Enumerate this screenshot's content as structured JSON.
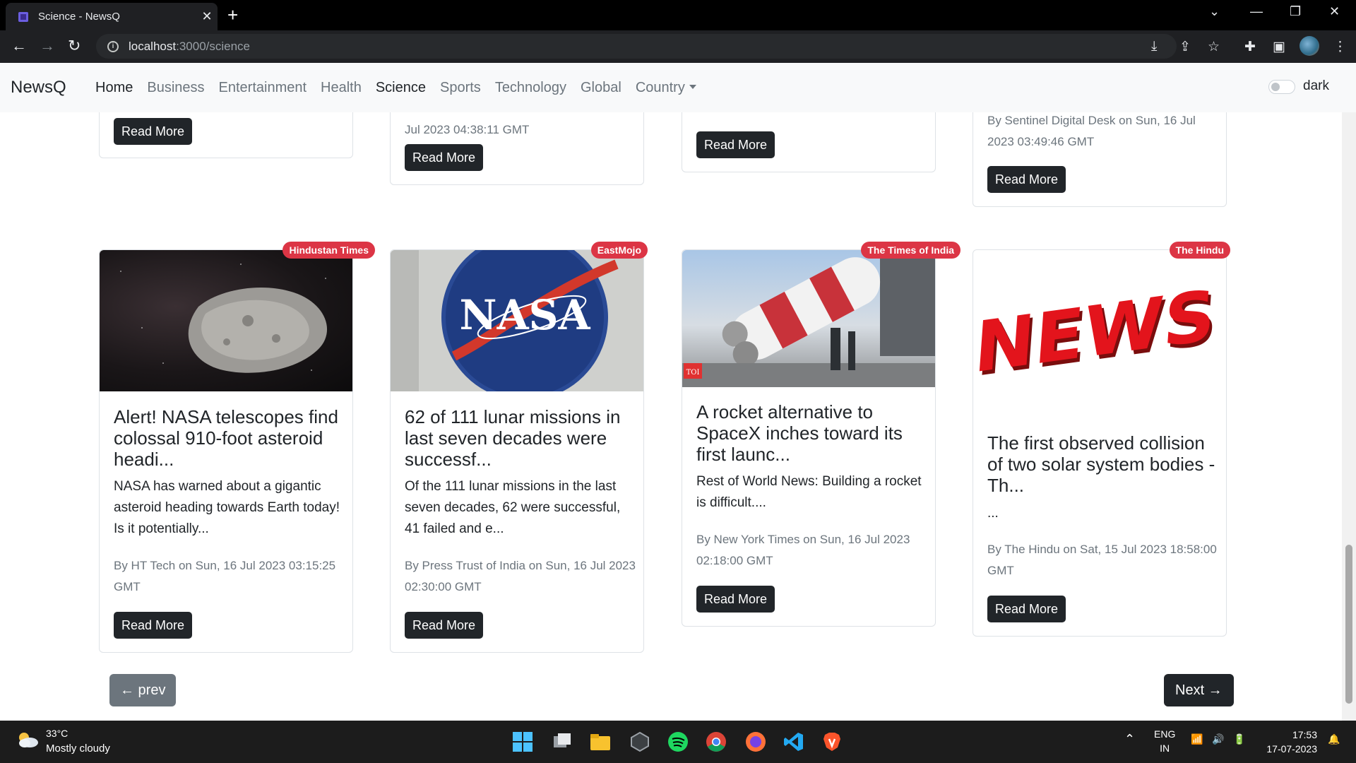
{
  "browser": {
    "tab_title": "Science - NewsQ",
    "tab_close": "✕",
    "new_tab": "+",
    "url_host": "localhost",
    "url_path": ":3000/science"
  },
  "navbar": {
    "brand": "NewsQ",
    "links": [
      "Home",
      "Business",
      "Entertainment",
      "Health",
      "Science",
      "Sports",
      "Technology",
      "Global",
      "Country"
    ],
    "dark_label": "dark"
  },
  "top_cards": [
    {
      "meta": "",
      "button": "Read More"
    },
    {
      "meta": "Jul 2023 04:38:11 GMT",
      "button": "Read More"
    },
    {
      "meta": "",
      "button": "Read More"
    },
    {
      "meta": "By Sentinel Digital Desk on Sun, 16 Jul 2023 03:49:46 GMT",
      "button": "Read More"
    }
  ],
  "cards": [
    {
      "source": "Hindustan Times",
      "title": "Alert! NASA telescopes find colossal 910-foot asteroid headi...",
      "description": "NASA has warned about a gigantic asteroid heading towards Earth today! Is it potentially...",
      "meta": "By HT Tech on Sun, 16 Jul 2023 03:15:25 GMT",
      "button": "Read More"
    },
    {
      "source": "EastMojo",
      "title": "62 of 111 lunar missions in last seven decades were successf...",
      "description": "Of the 111 lunar missions in the last seven decades, 62 were successful, 41 failed and e...",
      "meta": "By Press Trust of India on Sun, 16 Jul 2023 02:30:00 GMT",
      "button": "Read More",
      "image_text": "NASA"
    },
    {
      "source": "The Times of India",
      "title": "A rocket alternative to SpaceX inches toward its first launc...",
      "description": "Rest of World News: Building a rocket is difficult....",
      "meta": "By New York Times on Sun, 16 Jul 2023 02:18:00 GMT",
      "button": "Read More",
      "image_text": "TOI"
    },
    {
      "source": "The Hindu",
      "title": "The first observed collision of two solar system bodies - Th...",
      "description": "...",
      "meta": "By The Hindu on Sat, 15 Jul 2023 18:58:00 GMT",
      "button": "Read More",
      "image_text": "NEWS"
    }
  ],
  "pagination": {
    "prev": "← prev",
    "next": "Next →"
  },
  "taskbar": {
    "temperature": "33°C",
    "weather": "Mostly cloudy",
    "lang": "ENG",
    "region": "IN",
    "time": "17:53",
    "date": "17-07-2023"
  }
}
